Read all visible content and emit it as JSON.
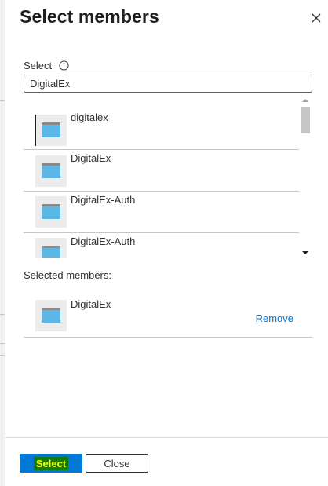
{
  "panel": {
    "title": "Select members"
  },
  "search": {
    "label": "Select",
    "value": "DigitalEx"
  },
  "results": [
    {
      "name": "digitalex",
      "focused": true
    },
    {
      "name": "DigitalEx",
      "focused": false
    },
    {
      "name": "DigitalEx-Auth",
      "focused": false
    },
    {
      "name": "DigitalEx-Auth",
      "focused": false
    }
  ],
  "selected": {
    "label": "Selected members:",
    "items": [
      {
        "name": "DigitalEx",
        "remove_label": "Remove"
      }
    ]
  },
  "footer": {
    "select_label": "Select",
    "close_label": "Close"
  },
  "icons": {
    "close": "close-icon",
    "info": "info-icon",
    "app": "application-icon"
  },
  "colors": {
    "accent": "#0078d4",
    "select_highlight_bg": "#107c10",
    "select_highlight_text": "#ffff00"
  }
}
